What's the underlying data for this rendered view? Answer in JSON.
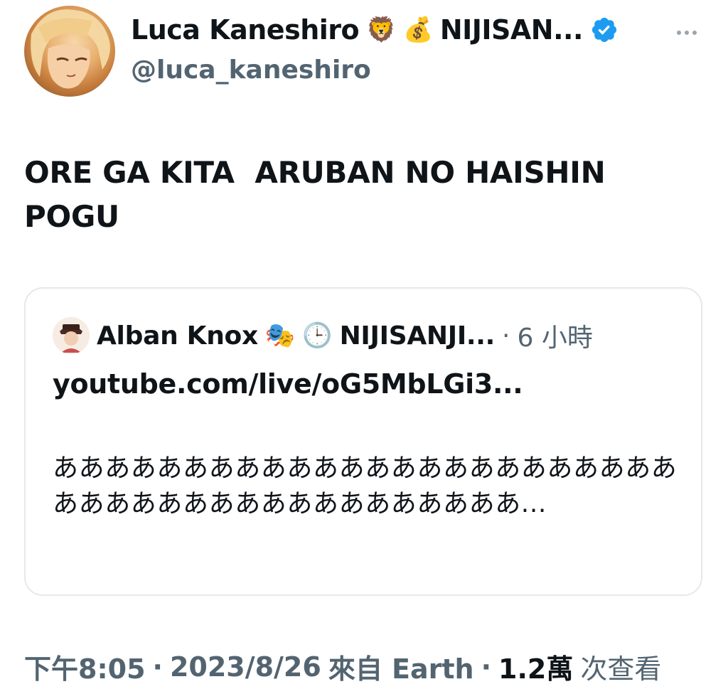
{
  "author": {
    "display_name": "Luca Kaneshiro",
    "name_emoji_1": "🦁",
    "name_emoji_2": "💰",
    "name_suffix": "NIJISAN...",
    "handle": "@luca_kaneshiro",
    "verified_color": "#1d9bf0"
  },
  "tweet": {
    "text": "ORE GA KITA  ARUBAN NO HAISHIN\nPOGU"
  },
  "quote": {
    "author_name": "Alban Knox",
    "emoji_1": "🎭",
    "emoji_2": "🕒",
    "name_suffix": "NIJISANJI...",
    "separator": "·",
    "time_ago": "6 小時",
    "link_text": "youtube.com/live/oG5MbLGi3...",
    "body": "ああああああああああああああああああああああああああああああああああああああああああ..."
  },
  "meta": {
    "time": "下午8:05",
    "sep1": "·",
    "date": "2023/8/26",
    "source": "來自 Earth",
    "sep2": "·",
    "views_count": "1.2萬",
    "views_label": "次查看"
  },
  "icons": {
    "verified": "verified-badge-icon",
    "more": "more-options-icon"
  }
}
